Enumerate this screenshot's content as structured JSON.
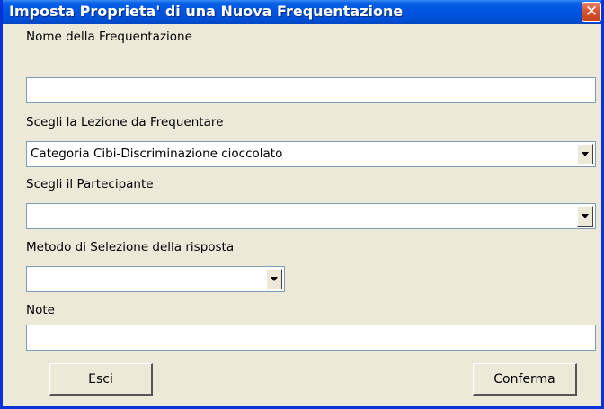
{
  "window": {
    "title": "Imposta Proprieta' di una Nuova Frequentazione",
    "close_glyph": "✕"
  },
  "form": {
    "name_label": "Nome della Frequentazione",
    "name_value": "",
    "lesson_label": "Scegli la Lezione da Frequentare",
    "lesson_value": "Categoria Cibi-Discriminazione cioccolato",
    "participant_label": "Scegli il Partecipante",
    "participant_value": "",
    "method_label": "Metodo di Selezione della risposta",
    "method_value": "",
    "notes_label": "Note",
    "notes_value": ""
  },
  "buttons": {
    "exit_label": "Esci",
    "confirm_label": "Conferma"
  },
  "colors": {
    "titlebar": "#0054E3",
    "dialog_background": "#ECE9D8",
    "close_button": "#D9552F",
    "field_border": "#7F9DB9"
  },
  "icons": {
    "close": "close-icon",
    "dropdown": "chevron-down-icon"
  }
}
